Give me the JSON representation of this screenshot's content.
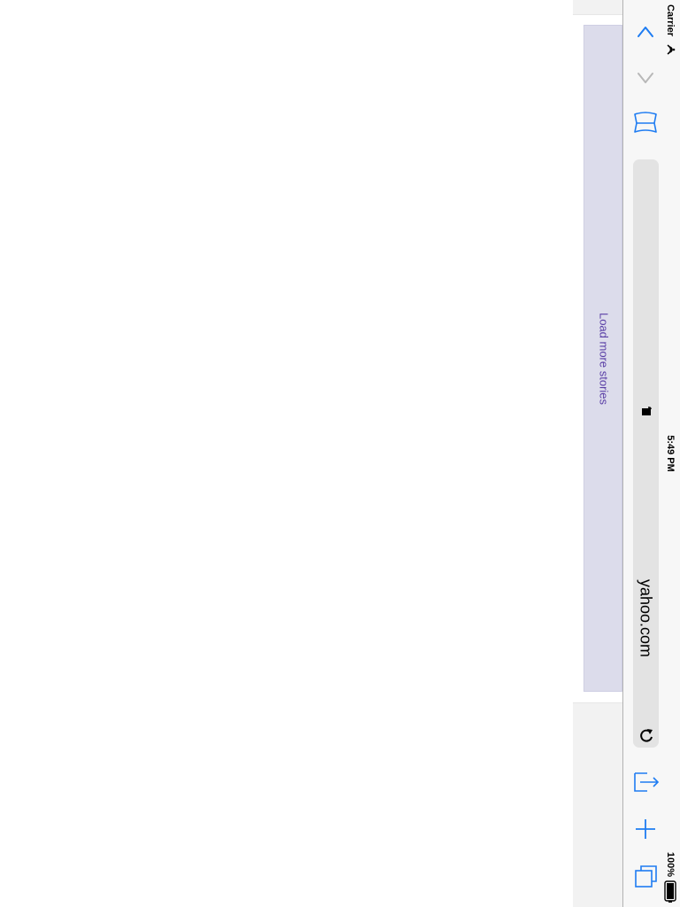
{
  "status_bar": {
    "carrier": "Carrier",
    "time": "5:49 PM",
    "battery": "100%",
    "wifi_icon": "wifi-icon",
    "battery_icon": "battery-icon"
  },
  "toolbar": {
    "url": "yahoo.com",
    "icons": {
      "back": "chevron-up-icon",
      "forward": "chevron-down-icon",
      "bookmarks": "book-icon",
      "lock": "lock-icon",
      "reload": "reload-icon",
      "share": "share-icon",
      "new_tab": "plus-icon",
      "tabs": "tabs-icon"
    },
    "accent_color": "#1e7cf2",
    "disabled_color": "#b8b8b8"
  },
  "content": {
    "load_more_label": "Load more stories",
    "load_more_color": "#5a3fa6",
    "load_more_background": "#dcdceb"
  }
}
